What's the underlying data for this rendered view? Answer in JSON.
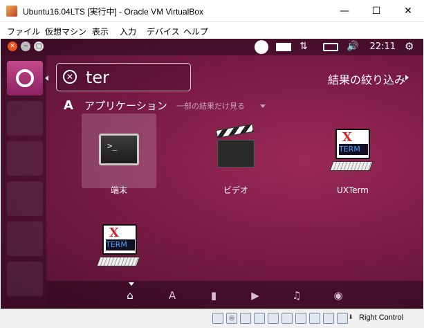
{
  "window": {
    "title": "Ubuntu16.04LTS [実行中] - Oracle VM VirtualBox",
    "minimize": "—",
    "maximize": "☐",
    "close": "✕"
  },
  "menubar": {
    "items": [
      "ファイル",
      "仮想マシン",
      "表示",
      "入力",
      "デバイス",
      "ヘルプ"
    ]
  },
  "panel": {
    "time": "22:11",
    "icons": [
      "circle-icon",
      "keyboard-icon",
      "network-icon",
      "battery-icon",
      "volume-icon",
      "gear-icon"
    ]
  },
  "dash": {
    "search_value": "ter",
    "filter_label": "結果の絞り込み",
    "section_title": "アプリケーション",
    "section_subtitle": "一部の結果だけ見る",
    "apps": [
      {
        "label": "端末",
        "icon": "terminal-icon",
        "selected": true
      },
      {
        "label": "ビデオ",
        "icon": "video-clapper-icon",
        "selected": false
      },
      {
        "label": "UXTerm",
        "icon": "xterm-icon",
        "selected": false
      },
      {
        "label": "",
        "icon": "xterm-icon",
        "selected": false
      }
    ],
    "terminal_prompt": ">_",
    "xterm_x": "X",
    "xterm_term": "TERM",
    "lenses": [
      {
        "icon": "home-icon",
        "glyph": "⌂"
      },
      {
        "icon": "applications-icon",
        "glyph": "A"
      },
      {
        "icon": "files-icon",
        "glyph": "▮"
      },
      {
        "icon": "video-icon",
        "glyph": "▶"
      },
      {
        "icon": "music-icon",
        "glyph": "♫"
      },
      {
        "icon": "photo-icon",
        "glyph": "◉"
      }
    ]
  },
  "statusbar": {
    "host_key": "Right Control"
  }
}
